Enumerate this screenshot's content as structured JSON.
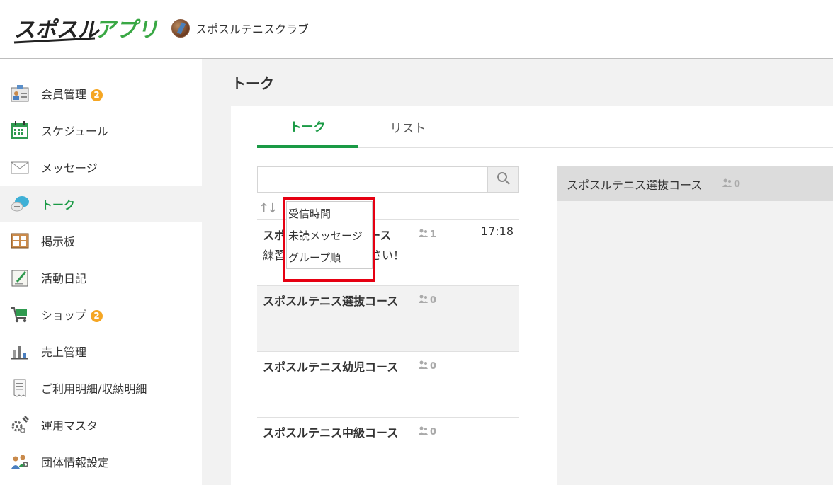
{
  "header": {
    "logo_text": "スポスルアプリ",
    "club_name": "スポスルテニスクラブ"
  },
  "sidebar": {
    "items": [
      {
        "label": "会員管理",
        "badge": "2",
        "icon": "member-card-icon"
      },
      {
        "label": "スケジュール",
        "badge": "",
        "icon": "calendar-icon"
      },
      {
        "label": "メッセージ",
        "badge": "",
        "icon": "envelope-icon"
      },
      {
        "label": "トーク",
        "badge": "",
        "icon": "chat-bubble-icon",
        "active": true
      },
      {
        "label": "掲示板",
        "badge": "",
        "icon": "bulletin-board-icon"
      },
      {
        "label": "活動日記",
        "badge": "",
        "icon": "diary-icon"
      },
      {
        "label": "ショップ",
        "badge": "2",
        "icon": "shopping-cart-icon"
      },
      {
        "label": "売上管理",
        "badge": "",
        "icon": "sales-chart-icon"
      },
      {
        "label": "ご利用明細/収納明細",
        "badge": "",
        "icon": "receipt-icon"
      },
      {
        "label": "運用マスタ",
        "badge": "",
        "icon": "gear-wrench-icon"
      },
      {
        "label": "団体情報設定",
        "badge": "",
        "icon": "group-settings-icon"
      }
    ]
  },
  "main": {
    "page_title": "トーク",
    "tabs": [
      {
        "label": "トーク",
        "active": true
      },
      {
        "label": "リスト",
        "active": false
      }
    ],
    "search": {
      "placeholder": "",
      "value": ""
    },
    "sort_icon": "sort-arrows-icon",
    "sort_options": [
      "受信時間",
      "未読メッセージ",
      "グループ順"
    ],
    "talks": [
      {
        "name": "スポスルテニス選抜コース",
        "name_visible": "スポ",
        "name_tail": "ース",
        "count": "1",
        "time": "17:18",
        "preview_head": "練習",
        "preview_tail": "さい！"
      },
      {
        "name": "スポスルテニス選抜コース",
        "count": "0",
        "time": "",
        "preview": ""
      },
      {
        "name": "スポスルテニス幼児コース",
        "count": "0",
        "time": "",
        "preview": ""
      },
      {
        "name": "スポスルテニス中級コース",
        "count": "0",
        "time": "",
        "preview": ""
      }
    ],
    "chat": {
      "title": "スポスルテニス選抜コース",
      "count": "0"
    }
  },
  "colors": {
    "accent_green": "#1a9a45",
    "badge_orange": "#f5a623",
    "highlight_red": "#e60012",
    "main_bg": "#f2f2f2"
  }
}
